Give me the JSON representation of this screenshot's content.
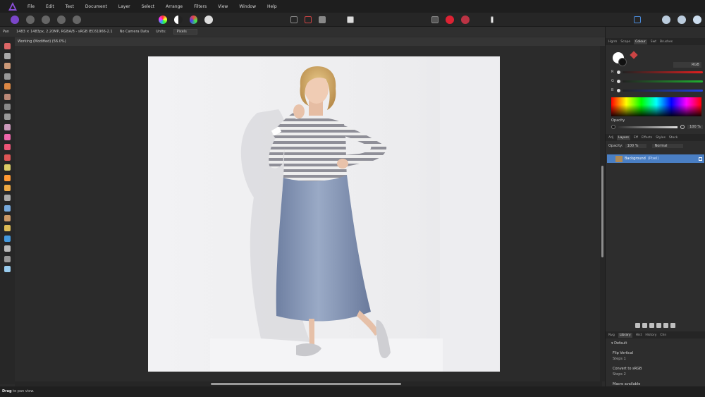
{
  "menubar": {
    "items": [
      "File",
      "Edit",
      "Text",
      "Document",
      "Layer",
      "Select",
      "Arrange",
      "Filters",
      "View",
      "Window",
      "Help"
    ]
  },
  "contextbar": {
    "doc_info": "1483 × 1483px, 2.20MP, RGBA/8 - sRGB IEC61966-2.1",
    "camera": "No Camera Data",
    "units_label": "Units:",
    "units_value": "Pixels"
  },
  "doctab": {
    "title": "Working (Modified) (56.0%)"
  },
  "right_panel": {
    "top_tabs": [
      "Hgrm",
      "Scope",
      "Colour",
      "Swt",
      "Brushes"
    ],
    "active_top_tab": "Colour",
    "color_mode": "RGB",
    "sliders": [
      {
        "label": "R",
        "color": "#e02020"
      },
      {
        "label": "G",
        "color": "#20b030"
      },
      {
        "label": "B",
        "color": "#2040e0"
      }
    ],
    "opacity_label": "Opacity",
    "opacity_value": "100 %",
    "layer_tabs": [
      "Adj",
      "Layers",
      "Eff",
      "Effects",
      "Styles",
      "Stock"
    ],
    "layer_opacity_label": "Opacity:",
    "layer_opacity_value": "100 %",
    "blend_mode": "Normal",
    "layer_name": "Background",
    "layer_type": "(Pixel)",
    "bottom_tabs": [
      "Nvg",
      "Library",
      "Hist",
      "History",
      "Chn"
    ],
    "history_group": "Default",
    "history_items": [
      {
        "title": "Flip Vertical",
        "step": "Steps 1"
      },
      {
        "title": "Convert to sRGB",
        "step": "Steps 2"
      },
      {
        "title": "Macro available",
        "step": ""
      }
    ]
  },
  "statusbar": {
    "bold": "Drag",
    "text": "to pan view."
  }
}
